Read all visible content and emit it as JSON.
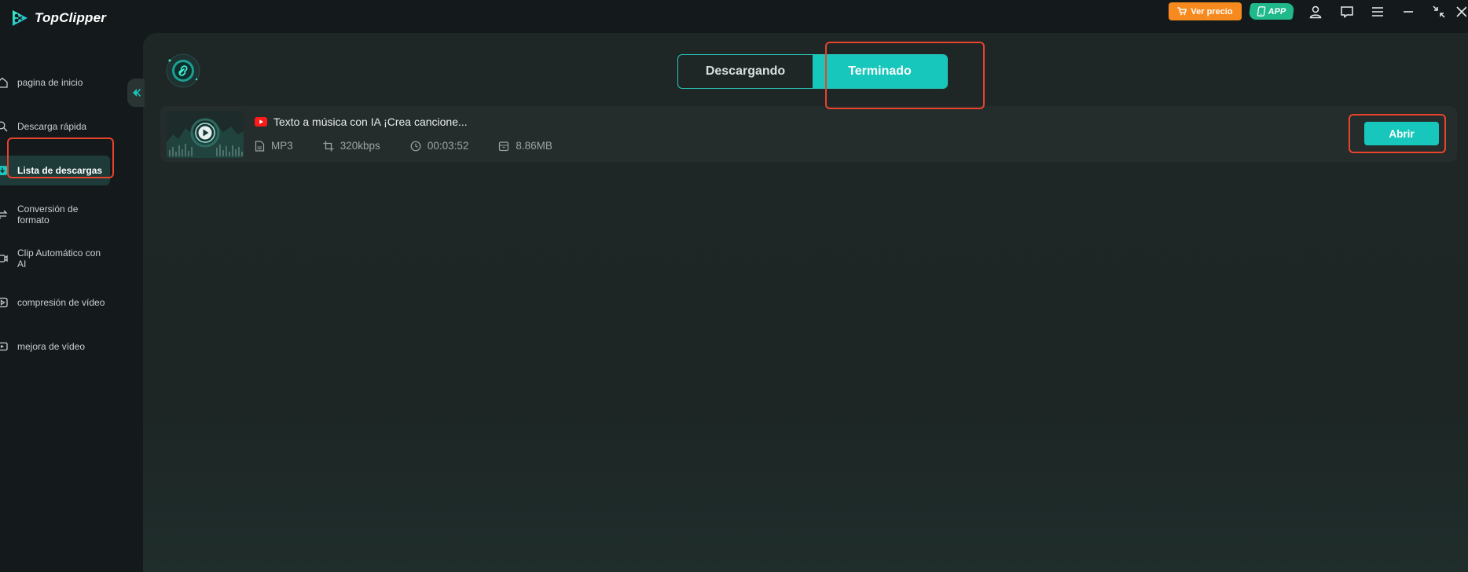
{
  "app": {
    "name": "TopClipper"
  },
  "titlebar": {
    "price_label": "Ver precio",
    "app_label": "APP",
    "icons": [
      "user-icon",
      "chat-icon",
      "menu-icon",
      "minimize-icon",
      "restore-icon",
      "close-icon"
    ]
  },
  "sidebar": {
    "items": [
      {
        "label": "pagina de inicio",
        "icon": "home-icon"
      },
      {
        "label": "Descarga rápida",
        "icon": "search-icon"
      },
      {
        "label": "Lista de descargas",
        "icon": "download-list-icon",
        "active": true
      },
      {
        "label": "Conversión de formato",
        "icon": "convert-icon"
      },
      {
        "label": "Clip Automático con AI",
        "icon": "ai-clip-icon"
      },
      {
        "label": "compresión de vídeo",
        "icon": "compress-icon"
      },
      {
        "label": "mejora de vídeo",
        "icon": "enhance-icon"
      }
    ]
  },
  "tabs": {
    "downloading": "Descargando",
    "finished": "Terminado",
    "selected": "finished"
  },
  "downloads": [
    {
      "source": "youtube",
      "title": "Texto a música con IA ¡Crea cancione...",
      "format": "MP3",
      "bitrate": "320kbps",
      "duration": "00:03:52",
      "size": "8.86MB",
      "action_label": "Abrir"
    }
  ],
  "colors": {
    "accent": "#18c7bc",
    "price_button": "#f78a1e",
    "app_button": "#1fb98b",
    "highlight": "#e8432d"
  }
}
